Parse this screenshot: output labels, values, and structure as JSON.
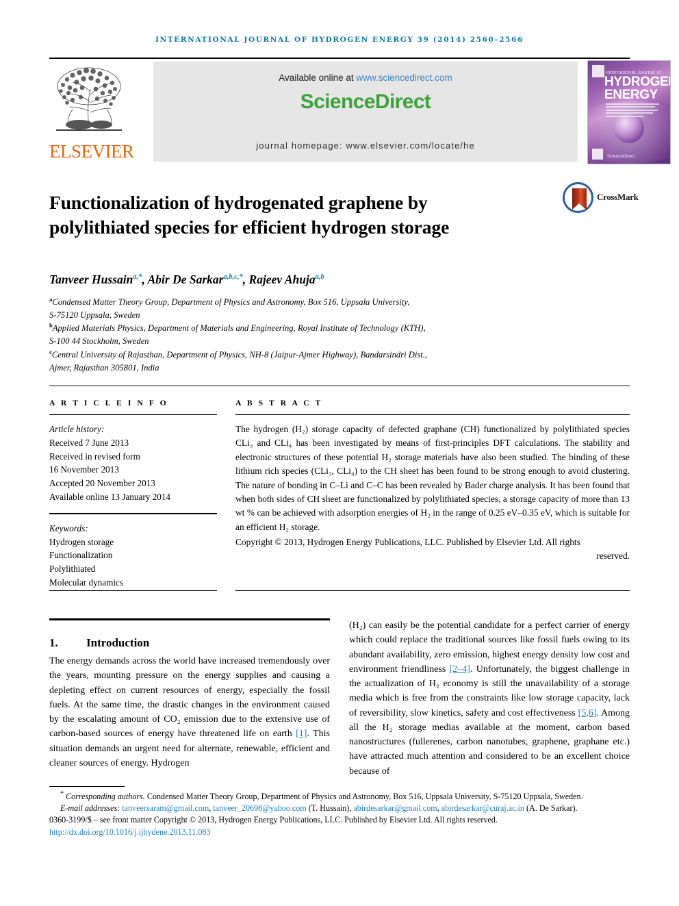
{
  "running_head": "International Journal of Hydrogen Energy 39 (2014) 2560–2566",
  "masthead": {
    "publisher_name": "ELSEVIER",
    "publisher_logo_icon": "elsevier-tree-icon",
    "available_prefix": "Available online at ",
    "sciencedirect_url": "www.sciencedirect.com",
    "sciencedirect_logo": "ScienceDirect",
    "journal_homepage": "journal homepage: www.elsevier.com/locate/he",
    "cover": {
      "line_small": "International Journal of",
      "line_big_1": "HYDROGEN",
      "line_big_2": "ENERGY",
      "footer_text": "ScienceDirect"
    }
  },
  "article": {
    "title": "Functionalization of hydrogenated graphene by polylithiated species for efficient hydrogen storage",
    "crossmark_label": "CrossMark",
    "authors": [
      {
        "name": "Tanveer Hussain",
        "marks": "a,*"
      },
      {
        "name": "Abir De Sarkar",
        "marks": "a,b,c,*"
      },
      {
        "name": "Rajeev Ahuja",
        "marks": "a,b"
      }
    ],
    "affiliations": [
      {
        "mark": "a",
        "lines": [
          "Condensed Matter Theory Group, Department of Physics and Astronomy, Box 516, Uppsala University,",
          "S-75120 Uppsala, Sweden"
        ]
      },
      {
        "mark": "b",
        "lines": [
          "Applied Materials Physics, Department of Materials and Engineering, Royal Institute of Technology (KTH),",
          "S-100 44 Stockholm, Sweden"
        ]
      },
      {
        "mark": "c",
        "lines": [
          "Central University of Rajasthan, Department of Physics, NH-8 (Jaipur-Ajmer Highway), Bandarsindri Dist.,",
          "Ajmer, Rajasthan 305801, India"
        ]
      }
    ]
  },
  "article_info": {
    "heading": "A R T I C L E   I N F O",
    "history_label": "Article history:",
    "history": [
      "Received 7 June 2013",
      "Received in revised form",
      "16 November 2013",
      "Accepted 20 November 2013",
      "Available online 13 January 2014"
    ],
    "keywords_label": "Keywords:",
    "keywords": [
      "Hydrogen storage",
      "Functionalization",
      "Polylithiated",
      "Molecular dynamics"
    ]
  },
  "abstract": {
    "heading": "A B S T R A C T",
    "text": "The hydrogen (H2) storage capacity of defected graphane (CH) functionalized by polylithiated species CLi3 and CLi4 has been investigated by means of first-principles DFT calculations. The stability and electronic structures of these potential H2 storage materials have also been studied. The binding of these lithium rich species (CLi3, CLi4) to the CH sheet has been found to be strong enough to avoid clustering. The nature of bonding in C–Li and C–C has been revealed by Bader charge analysis. It has been found that when both sides of CH sheet are functionalized by polylithiated species, a storage capacity of more than 13 wt % can be achieved with adsorption energies of H2 in the range of 0.25 eV–0.35 eV, which is suitable for an efficient H2 storage.",
    "copyright_main": "Copyright © 2013, Hydrogen Energy Publications, LLC. Published by Elsevier Ltd. All rights",
    "copyright_tail": "reserved."
  },
  "body": {
    "section_number": "1.",
    "section_title": "Introduction",
    "left_paragraph_1": "The energy demands across the world have increased tremendously over the years, mounting pressure on the energy supplies and causing a depleting effect on current resources of energy, especially the fossil fuels. At the same time, the drastic changes in the environment caused by the escalating amount of CO2 emission due to the extensive use of carbon-based sources of energy have threatened life on earth ",
    "left_ref_1": "[1]",
    "left_paragraph_1b": ". This situation demands an urgent need for alternate, renewable, efficient and cleaner sources of energy. Hydrogen",
    "right_paragraph_a": "(H2) can easily be the potential candidate for a perfect carrier of energy which could replace the traditional sources like fossil fuels owing to its abundant availability, zero emission, highest energy density low cost and environment friendliness ",
    "right_ref_1": "[2–4]",
    "right_paragraph_b": ". Unfortunately, the biggest challenge in the actualization of H2 economy is still the unavailability of a storage media which is free from the constraints like low storage capacity, lack of reversibility, slow kinetics, safety and cost effectiveness ",
    "right_ref_2": "[5,6]",
    "right_paragraph_c": ". Among all the H2 storage medias available at the moment, carbon based nanostructures (fullerenes, carbon nanotubes, graphene, graphane etc.) have attracted much attention and considered to be an excellent choice because of"
  },
  "footnotes": {
    "corresponding_star": "*",
    "corresponding_label": "Corresponding authors.",
    "corresponding_text": " Condensed Matter Theory Group, Department of Physics and Astronomy, Box 516, Uppsala University, S-75120 Uppsala, Sweden.",
    "email_label": "E-mail addresses:",
    "emails": [
      {
        "address": "tanveersaram@gmail.com",
        "sep": ", "
      },
      {
        "address": "tanveer_20698@yahoo.com",
        "sep": " "
      }
    ],
    "email_owner_1": "(T. Hussain), ",
    "emails2": [
      {
        "address": "abirdesarkar@gmail.com",
        "sep": ", "
      },
      {
        "address": "abirdesarkar@curaj.ac.in",
        "sep": " "
      }
    ],
    "email_owner_2": "(A. De Sarkar).",
    "issn_line": "0360-3199/$ – see front matter Copyright © 2013, Hydrogen Energy Publications, LLC. Published by Elsevier Ltd. All rights reserved.",
    "doi": "http://dx.doi.org/10.1016/j.ijhydene.2013.11.083"
  },
  "colors": {
    "journal_blue": "#0a7ba8",
    "link_blue": "#1f7fb5",
    "elsevier_orange": "#ec6608",
    "sciencedirect_green": "#3aa33a",
    "banner_grey": "#e6e6e6"
  }
}
